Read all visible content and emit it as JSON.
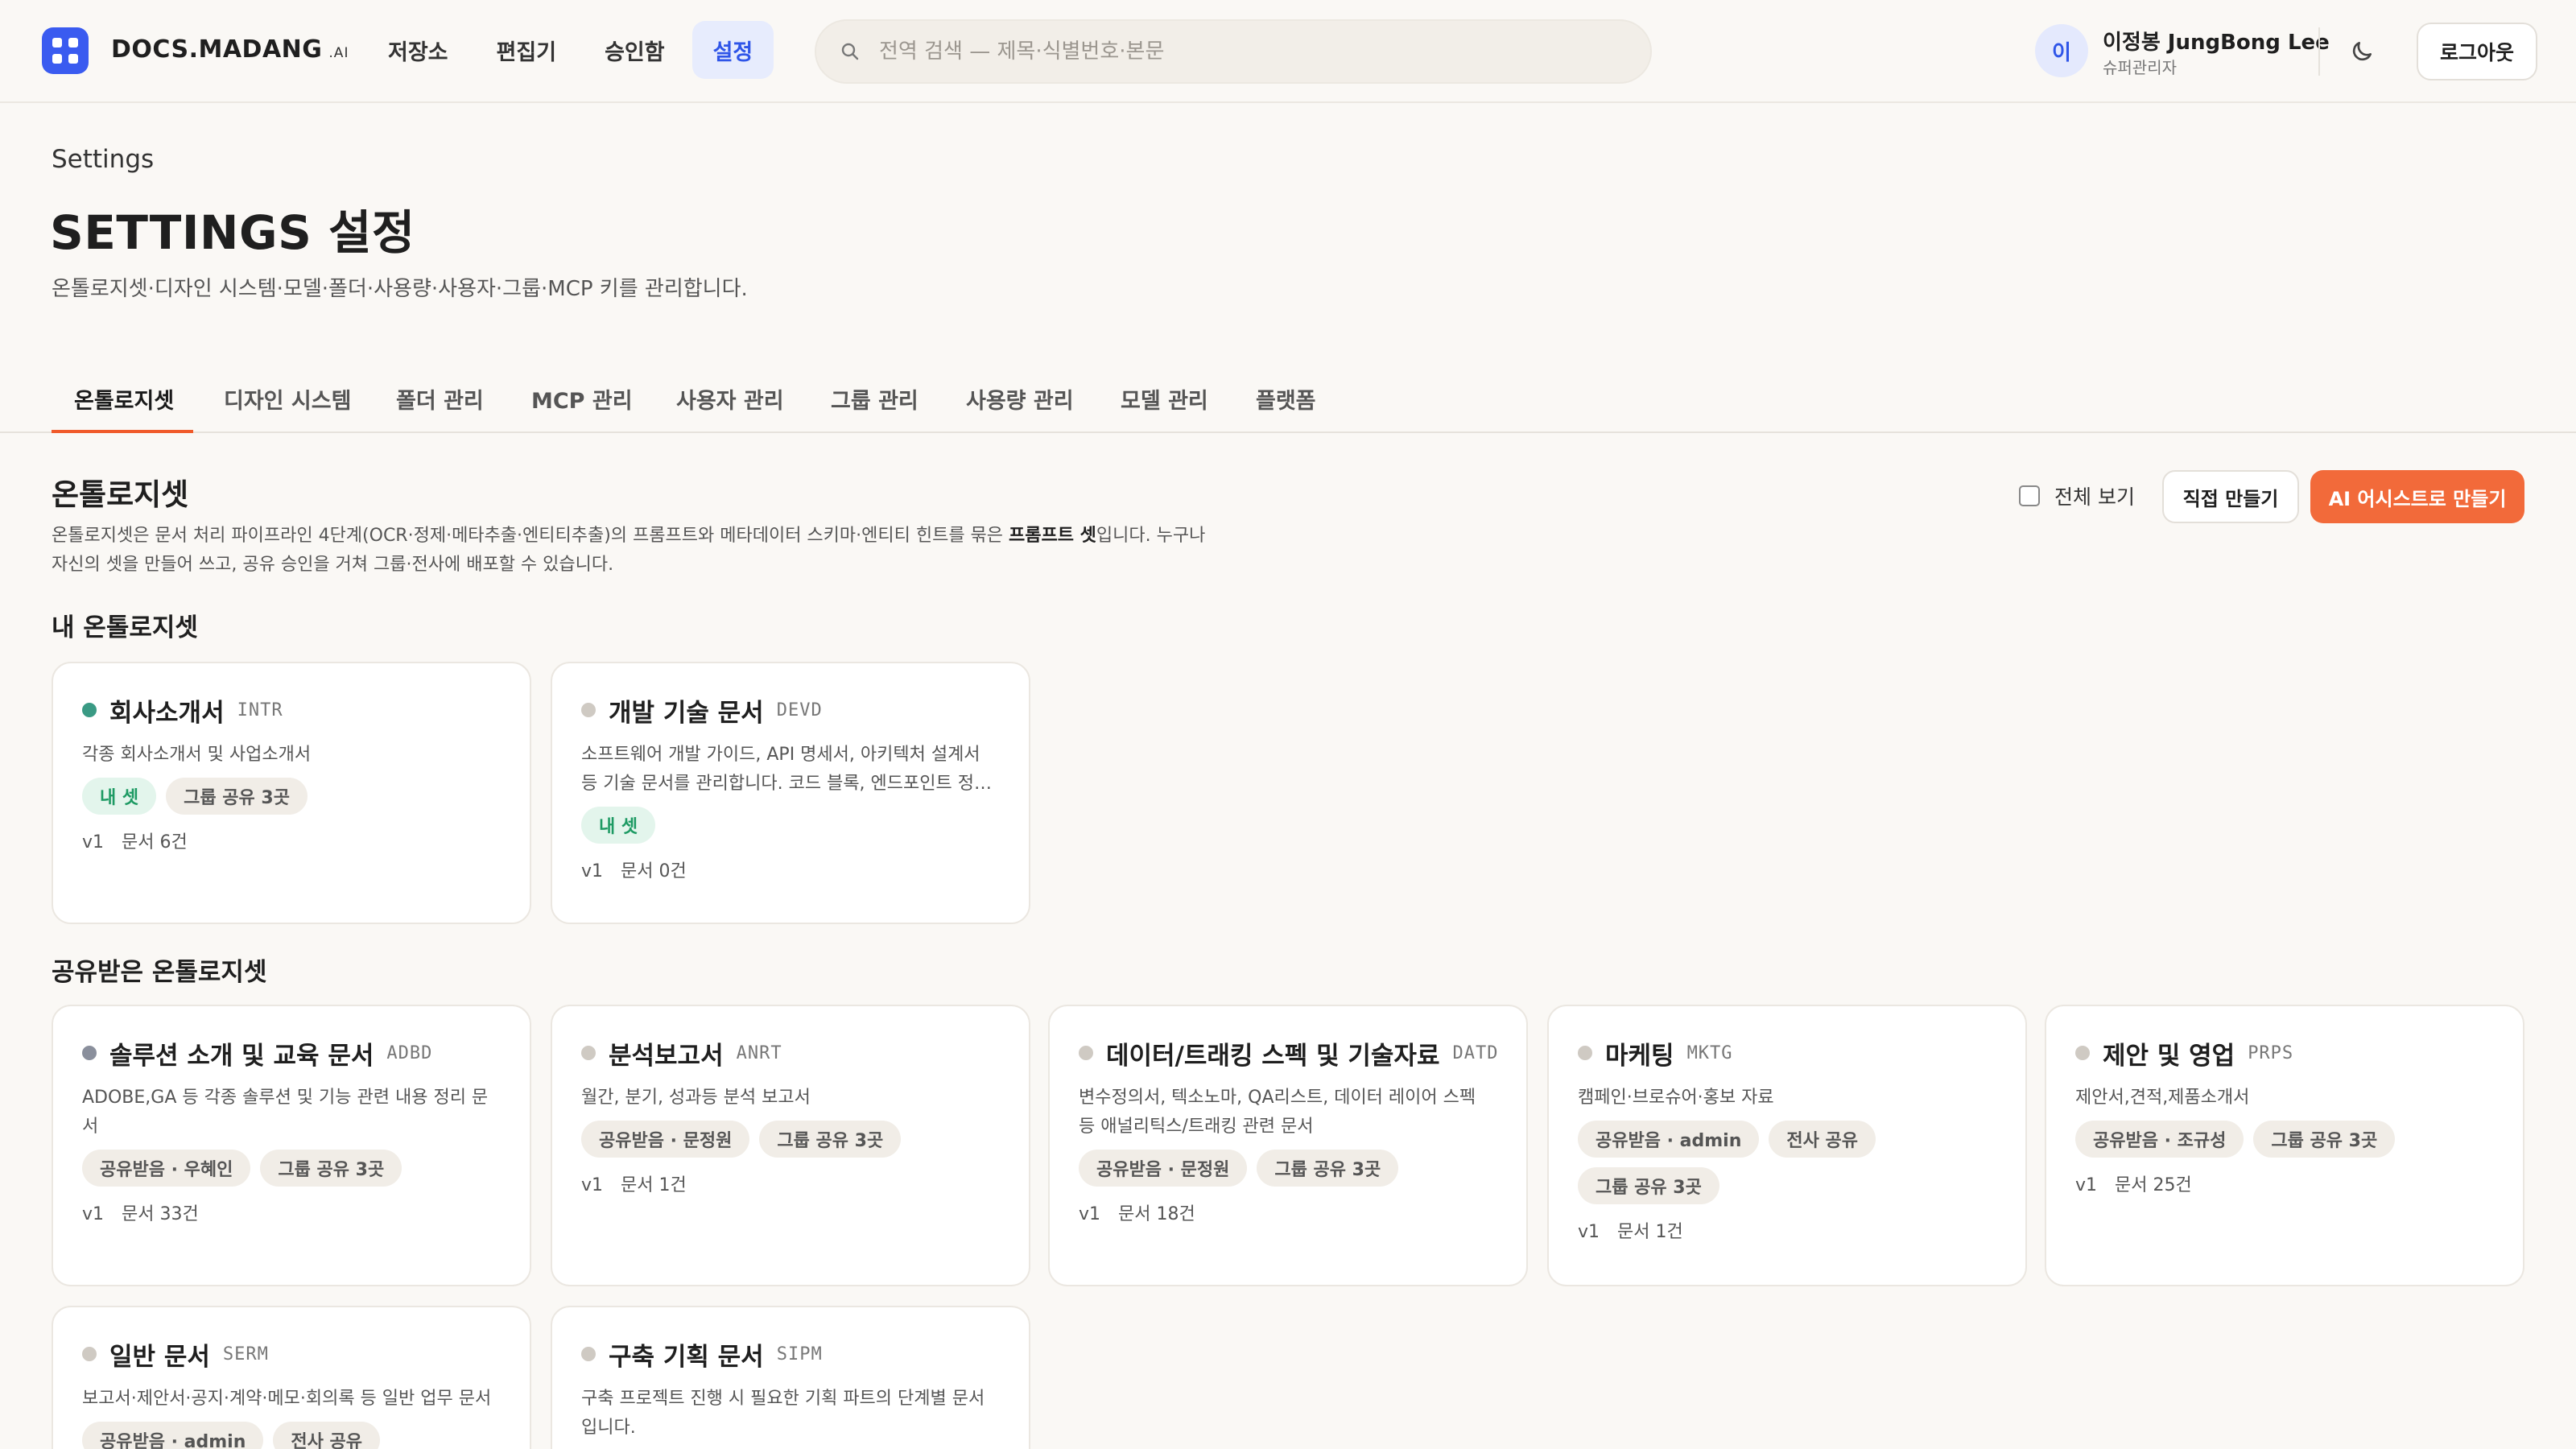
{
  "app": {
    "name": "DOCS.MADANG",
    "name_suffix": ".AI"
  },
  "nav": [
    {
      "label": "저장소",
      "active": false
    },
    {
      "label": "편집기",
      "active": false
    },
    {
      "label": "승인함",
      "active": false
    },
    {
      "label": "설정",
      "active": true
    }
  ],
  "search": {
    "placeholder": "전역 검색 — 제목·식별번호·본문",
    "value": ""
  },
  "user": {
    "initial": "이",
    "name": "이정봉 JungBong Lee",
    "role": "슈퍼관리자"
  },
  "header_actions": {
    "logout_label": "로그아웃"
  },
  "page": {
    "crumb": "Settings",
    "title": "SETTINGS 설정",
    "description": "온톨로지셋·디자인 시스템·모델·폴더·사용량·사용자·그룹·MCP 키를 관리합니다."
  },
  "tabs": [
    {
      "label": "온톨로지셋",
      "active": true
    },
    {
      "label": "디자인 시스템",
      "active": false
    },
    {
      "label": "폴더 관리",
      "active": false
    },
    {
      "label": "MCP 관리",
      "active": false
    },
    {
      "label": "사용자 관리",
      "active": false
    },
    {
      "label": "그룹 관리",
      "active": false
    },
    {
      "label": "사용량 관리",
      "active": false
    },
    {
      "label": "모델 관리",
      "active": false
    },
    {
      "label": "플랫폼",
      "active": false
    }
  ],
  "section": {
    "title": "온톨로지셋",
    "desc_before": "온톨로지셋은 문서 처리 파이프라인 4단계(OCR·정제·메타추출·엔티티추출)의 프롬프트와 메타데이터 스키마·엔티티 힌트를 묶은 ",
    "desc_bold": "프롬프트 셋",
    "desc_after": "입니다. 누구나 자신의 셋을 만들어 쓰고, 공유 승인을 거쳐 그룹·전사에 배포할 수 있습니다.",
    "show_all_label": "전체 보기",
    "show_all_checked": false,
    "create_manual_label": "직접 만들기",
    "create_ai_label": "AI 어시스트로 만들기"
  },
  "my_sets": {
    "title": "내 온톨로지셋",
    "cards": [
      {
        "name": "회사소개서",
        "code": "INTR",
        "dot_color": "#3a9a84",
        "description": "각종 회사소개서 및 사업소개서",
        "chips": [
          {
            "label": "내 셋",
            "kind": "mine"
          },
          {
            "label": "그룹 공유 3곳",
            "kind": "plain"
          }
        ],
        "version": "v1",
        "doc_count": "문서 6건"
      },
      {
        "name": "개발 기술 문서",
        "code": "DEVD",
        "dot_color": "#cfcac3",
        "description": "소프트웨어 개발 가이드, API 명세서, 아키텍처 설계서 등 기술 문서를 관리합니다. 코드 블록, 엔드포인트 정의, 데이터 모델, 에러 코드 등 기술 정보를 구조화합니다.",
        "chips": [
          {
            "label": "내 셋",
            "kind": "mine"
          }
        ],
        "version": "v1",
        "doc_count": "문서 0건"
      }
    ]
  },
  "shared_sets": {
    "title": "공유받은 온톨로지셋",
    "cards": [
      {
        "name": "솔루션 소개 및 교육 문서",
        "code": "ADBD",
        "dot_color": "#8a8f9c",
        "description": "ADOBE,GA 등 각종 솔루션 및 기능 관련 내용 정리 문서",
        "chips": [
          {
            "label": "공유받음 · 우혜인",
            "kind": "plain"
          },
          {
            "label": "그룹 공유 3곳",
            "kind": "plain"
          }
        ],
        "version": "v1",
        "doc_count": "문서 33건"
      },
      {
        "name": "분석보고서",
        "code": "ANRT",
        "dot_color": "#cfcac3",
        "description": "월간, 분기, 성과등 분석 보고서",
        "chips": [
          {
            "label": "공유받음 · 문정원",
            "kind": "plain"
          },
          {
            "label": "그룹 공유 3곳",
            "kind": "plain"
          }
        ],
        "version": "v1",
        "doc_count": "문서 1건"
      },
      {
        "name": "데이터/트래킹 스펙 및 기술자료",
        "code": "DATD",
        "dot_color": "#cfcac3",
        "description": "변수정의서, 텍소노마, QA리스트, 데이터 레이어 스펙 등 애널리틱스/트래킹 관련 문서",
        "chips": [
          {
            "label": "공유받음 · 문정원",
            "kind": "plain"
          },
          {
            "label": "그룹 공유 3곳",
            "kind": "plain"
          }
        ],
        "version": "v1",
        "doc_count": "문서 18건"
      },
      {
        "name": "마케팅",
        "code": "MKTG",
        "dot_color": "#cfcac3",
        "description": "캠페인·브로슈어·홍보 자료",
        "chips": [
          {
            "label": "공유받음 · admin",
            "kind": "plain"
          },
          {
            "label": "전사 공유",
            "kind": "plain"
          },
          {
            "label": "그룹 공유 3곳",
            "kind": "plain"
          }
        ],
        "version": "v1",
        "doc_count": "문서 1건"
      },
      {
        "name": "제안 및 영업",
        "code": "PRPS",
        "dot_color": "#cfcac3",
        "description": "제안서,견적,제품소개서",
        "chips": [
          {
            "label": "공유받음 · 조규성",
            "kind": "plain"
          },
          {
            "label": "그룹 공유 3곳",
            "kind": "plain"
          }
        ],
        "version": "v1",
        "doc_count": "문서 25건"
      },
      {
        "name": "일반 문서",
        "code": "SERM",
        "dot_color": "#cfcac3",
        "description": "보고서·제안서·공지·계약·메모·회의록 등 일반 업무 문서",
        "chips": [
          {
            "label": "공유받음 · admin",
            "kind": "plain"
          },
          {
            "label": "전사 공유",
            "kind": "plain"
          }
        ],
        "version": "",
        "doc_count": ""
      },
      {
        "name": "구축 기획 문서",
        "code": "SIPM",
        "dot_color": "#cfcac3",
        "description": "구축 프로젝트 진행 시 필요한 기획 파트의 단계별 문서입니다.",
        "chips": [],
        "version": "",
        "doc_count": ""
      }
    ]
  }
}
